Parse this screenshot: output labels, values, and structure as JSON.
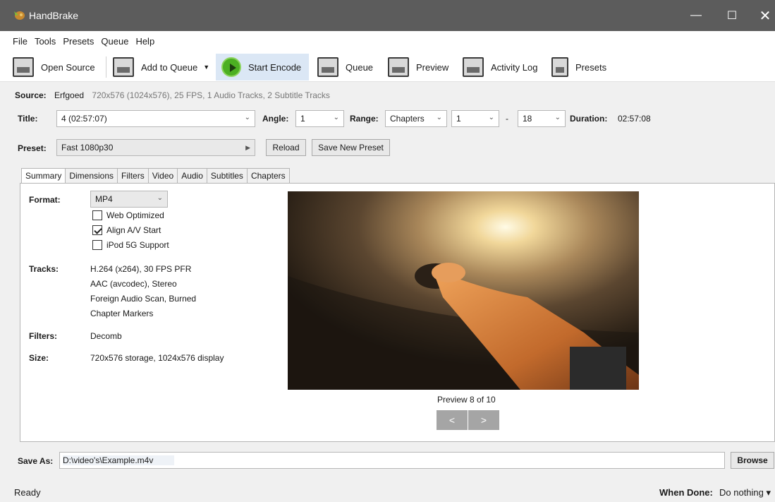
{
  "window": {
    "title": "HandBrake",
    "min": "—",
    "max": "☐",
    "close": "✕"
  },
  "menu": [
    "File",
    "Tools",
    "Presets",
    "Queue",
    "Help"
  ],
  "toolbar": {
    "open_source": "Open Source",
    "add_to_queue": "Add to Queue",
    "start_encode": "Start Encode",
    "queue": "Queue",
    "preview": "Preview",
    "activity_log": "Activity Log",
    "presets": "Presets"
  },
  "source": {
    "label": "Source:",
    "name": "Erfgoed",
    "meta": "720x576 (1024x576), 25 FPS, 1 Audio Tracks, 2 Subtitle Tracks"
  },
  "title_row": {
    "title_label": "Title:",
    "title_value": "4 (02:57:07)",
    "angle_label": "Angle:",
    "angle_value": "1",
    "range_label": "Range:",
    "range_type": "Chapters",
    "range_start": "1",
    "range_dash": "-",
    "range_end": "18",
    "duration_label": "Duration:",
    "duration_value": "02:57:08"
  },
  "preset_row": {
    "label": "Preset:",
    "value": "Fast 1080p30",
    "reload": "Reload",
    "save_new": "Save New Preset"
  },
  "tabs": [
    "Summary",
    "Dimensions",
    "Filters",
    "Video",
    "Audio",
    "Subtitles",
    "Chapters"
  ],
  "summary": {
    "format_label": "Format:",
    "format_value": "MP4",
    "web_optimized": "Web Optimized",
    "align_av": "Align A/V Start",
    "ipod": "iPod 5G Support",
    "tracks_label": "Tracks:",
    "tracks": [
      "H.264 (x264), 30 FPS PFR",
      "AAC (avcodec), Stereo",
      "Foreign Audio Scan, Burned",
      "Chapter Markers"
    ],
    "filters_label": "Filters:",
    "filters_value": "Decomb",
    "size_label": "Size:",
    "size_value": "720x576 storage, 1024x576 display"
  },
  "preview": {
    "caption": "Preview 8 of 10",
    "prev": "<",
    "next": ">"
  },
  "save": {
    "label": "Save As:",
    "value": "D:\\video's\\Example.m4v",
    "browse": "Browse"
  },
  "status": {
    "text": "Ready",
    "when_done_label": "When Done:",
    "when_done_value": "Do nothing ▾"
  }
}
